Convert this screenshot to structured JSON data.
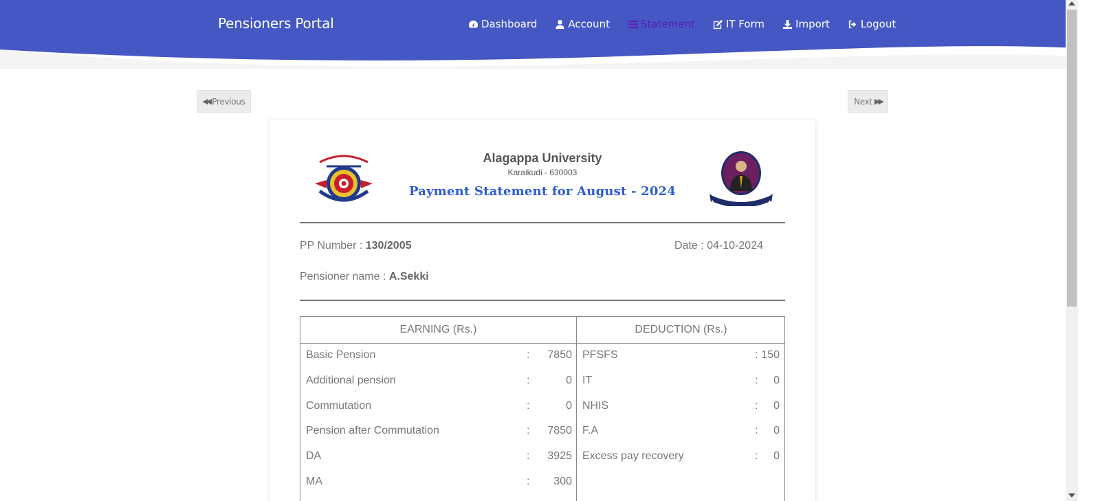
{
  "header": {
    "brand": "Pensioners Portal",
    "bg_color": "#4457c2",
    "nav": [
      {
        "label": "Dashboard",
        "icon": "dashboard-icon",
        "active": false
      },
      {
        "label": "Account",
        "icon": "user-icon",
        "active": false
      },
      {
        "label": "Statement",
        "icon": "list-icon",
        "active": true
      },
      {
        "label": "IT Form",
        "icon": "edit-icon",
        "active": false
      },
      {
        "label": "Import",
        "icon": "download-icon",
        "active": false
      },
      {
        "label": "Logout",
        "icon": "logout-icon",
        "active": false
      }
    ]
  },
  "pager": {
    "previous": "Previous",
    "next": "Next"
  },
  "statement": {
    "university": "Alagappa University",
    "city": "Karaikudi - 630003",
    "title": "Payment Statement for August - 2024",
    "pp_label": "PP Number : ",
    "pp_number": "130/2005",
    "date_label": "Date : ",
    "date": "04-10-2024",
    "name_label": "Pensioner name : ",
    "name": "A.Sekki"
  },
  "table": {
    "earning_header": "EARNING (Rs.)",
    "deduction_header": "DEDUCTION (Rs.)",
    "earnings": [
      {
        "label": "Basic Pension",
        "value": "7850"
      },
      {
        "label": "Additional pension",
        "value": "0"
      },
      {
        "label": "Commutation",
        "value": "0"
      },
      {
        "label": "Pension after Commutation",
        "value": "7850"
      },
      {
        "label": "DA",
        "value": "3925"
      },
      {
        "label": "MA",
        "value": "300"
      }
    ],
    "deductions": [
      {
        "label": "PFSFS",
        "value": "150"
      },
      {
        "label": "IT",
        "value": "0"
      },
      {
        "label": "NHIS",
        "value": "0"
      },
      {
        "label": "F.A",
        "value": "0"
      },
      {
        "label": "Excess pay recovery",
        "value": "0"
      }
    ]
  }
}
